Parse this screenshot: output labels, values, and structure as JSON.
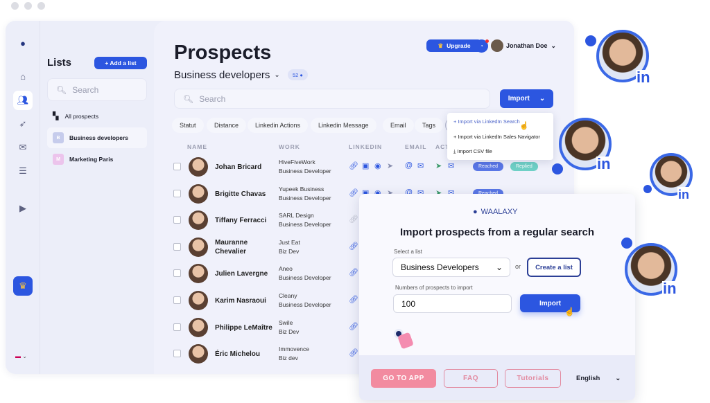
{
  "colors": {
    "accent": "#2c56e0",
    "pink": "#f07a94",
    "reached": "#5a77e6",
    "replied": "#6fd0c6"
  },
  "sidebar": {
    "nav_icons": [
      "logo-icon",
      "home-icon",
      "users-icon",
      "rocket-icon",
      "mail-icon",
      "list-icon",
      "play-icon",
      "crown-icon",
      "flag-icon"
    ]
  },
  "lists": {
    "title": "Lists",
    "add_label": "+ Add a list",
    "search_placeholder": "Search",
    "items": [
      {
        "label": "All prospects"
      },
      {
        "badge": "B",
        "label": "Business developers"
      },
      {
        "badge": "M",
        "label": "Marketing Paris"
      }
    ]
  },
  "header": {
    "title": "Prospects",
    "list_selector": "Business developers",
    "count": "52",
    "upgrade": "Upgrade",
    "user": "Jonathan Doe"
  },
  "search": {
    "placeholder": "Search"
  },
  "import_button": "Import",
  "filters": [
    "Statut",
    "Distance",
    "Linkedin Actions",
    "Linkedin Message",
    "Email",
    "Tags"
  ],
  "columns": {
    "name": "NAME",
    "work": "WORK",
    "linkedin": "LINKEDIN",
    "email": "EMAIL",
    "actions": "ACT"
  },
  "import_menu": [
    "Import via LinkedIn Search",
    "Import via LinkedIn Sales Navigator",
    "Import CSV file"
  ],
  "prospects": [
    {
      "name": "Johan Bricard",
      "company": "HiveFiveWork",
      "title": "Business Developer",
      "tags": [
        "Reached",
        "Replied"
      ]
    },
    {
      "name": "Brigitte Chavas",
      "company": "Yupeek Business",
      "title": "Business Developer",
      "tags": [
        "Reached"
      ]
    },
    {
      "name": "Tiffany Ferracci",
      "company": "SARL Design",
      "title": "Business Developer",
      "tags": []
    },
    {
      "name": "Mauranne Chevalier",
      "company": "Just Eat",
      "title": "Biz Dev",
      "tags": []
    },
    {
      "name": "Julien Lavergne",
      "company": "Aneo",
      "title": "Business Developer",
      "tags": []
    },
    {
      "name": "Karim Nasraoui",
      "company": "Cleany",
      "title": "Business Developer",
      "tags": []
    },
    {
      "name": "Philippe LeMaître",
      "company": "Swile",
      "title": "Biz Dev",
      "tags": []
    },
    {
      "name": "Éric Michelou",
      "company": "Immovence",
      "title": "Biz dev",
      "tags": []
    }
  ],
  "modal": {
    "brand": "WAALAXY",
    "title": "Import prospects from a regular search",
    "select_label": "Select a list",
    "select_value": "Business Developers",
    "or": "or",
    "create_list": "Create a list",
    "count_label": "Numbers of prospects to import",
    "count_value": "100",
    "import": "Import",
    "footer": {
      "go_to_app": "GO TO APP",
      "faq": "FAQ",
      "tutorials": "Tutorials",
      "language": "English"
    }
  },
  "linkedin_badge": "in"
}
